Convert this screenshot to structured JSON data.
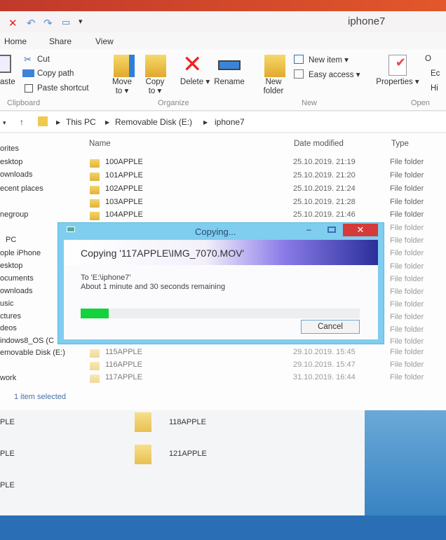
{
  "window": {
    "title": "iphone7"
  },
  "tabs": [
    "Home",
    "Share",
    "View"
  ],
  "ribbon": {
    "clipboard": {
      "paste": "aste",
      "cut": "Cut",
      "copy_path": "Copy path",
      "paste_shortcut": "Paste shortcut",
      "group": "Clipboard"
    },
    "organize": {
      "move_to": "Move to ▾",
      "copy_to": "Copy to ▾",
      "delete": "Delete ▾",
      "rename": "Rename",
      "group": "Organize"
    },
    "new": {
      "new_folder": "New folder",
      "new_item": "New item ▾",
      "easy_access": "Easy access ▾",
      "group": "New"
    },
    "open": {
      "properties": "Properties ▾",
      "o": "O",
      "e": "Ec",
      "h": "Hi",
      "group": "Open"
    }
  },
  "breadcrumb": [
    "This PC",
    "Removable Disk (E:)",
    "iphone7"
  ],
  "nav": [
    "orites",
    "esktop",
    "ownloads",
    "ecent places",
    "negroup",
    "PC",
    "ople iPhone",
    "esktop",
    "ocuments",
    "ownloads",
    "usic",
    "ctures",
    "deos",
    "indows8_OS (C",
    "emovable Disk (E:)",
    "work"
  ],
  "columns": {
    "name": "Name",
    "date": "Date modified",
    "type": "Type"
  },
  "rows": [
    {
      "name": "100APPLE",
      "date": "25.10.2019. 21:19",
      "type": "File folder"
    },
    {
      "name": "101APPLE",
      "date": "25.10.2019. 21:20",
      "type": "File folder"
    },
    {
      "name": "102APPLE",
      "date": "25.10.2019. 21:24",
      "type": "File folder"
    },
    {
      "name": "103APPLE",
      "date": "25.10.2019. 21:28",
      "type": "File folder"
    },
    {
      "name": "104APPLE",
      "date": "25.10.2019. 21:46",
      "type": "File folder"
    },
    {
      "type": "File folder"
    },
    {
      "type": "File folder"
    },
    {
      "type": "File folder"
    },
    {
      "type": "File folder"
    },
    {
      "type": "File folder"
    },
    {
      "type": "File folder"
    },
    {
      "type": "File folder"
    },
    {
      "type": "File folder"
    },
    {
      "type": "File folder"
    },
    {
      "type": "File folder"
    },
    {
      "name": "115APPLE",
      "date": "29.10.2019. 15:45",
      "type": "File folder"
    },
    {
      "name": "116APPLE",
      "date": "29.10.2019. 15:47",
      "type": "File folder"
    },
    {
      "name": "117APPLE",
      "date": "31.10.2019. 16:44",
      "type": "File folder"
    }
  ],
  "status": "1 item selected",
  "lower": {
    "left": [
      "PLE",
      "PLE",
      "PLE"
    ],
    "folders": [
      "118APPLE",
      "121APPLE"
    ]
  },
  "dialog": {
    "title": "Copying...",
    "heading": "Copying '117APPLE\\IMG_7070.MOV'",
    "to": "To 'E:\\iphone7'",
    "remaining": "About 1 minute and 30 seconds remaining",
    "progress_percent": 10,
    "cancel": "Cancel",
    "progress_color": "#14d23c"
  }
}
